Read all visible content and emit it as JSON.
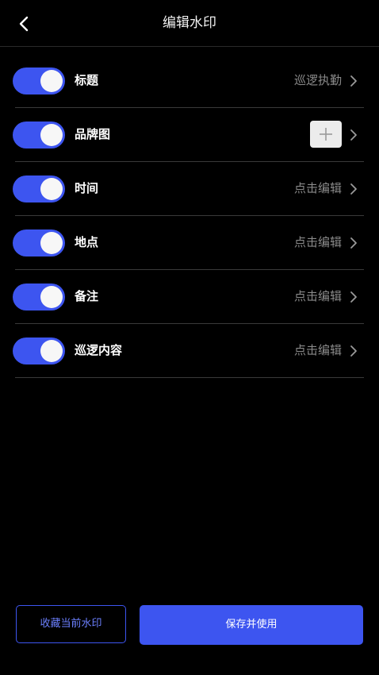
{
  "header": {
    "title": "编辑水印",
    "back_icon": "chevron-left-icon"
  },
  "colors": {
    "background": "#000000",
    "accent": "#3d55f0",
    "value_text": "#8a8a8a",
    "divider": "#3a3a3a"
  },
  "rows": [
    {
      "label": "标题",
      "value": "巡逻执勤",
      "enabled": true
    },
    {
      "label": "品牌图",
      "value": "",
      "enabled": true,
      "add_icon": "plus-icon"
    },
    {
      "label": "时间",
      "value": "点击编辑",
      "enabled": true
    },
    {
      "label": "地点",
      "value": "点击编辑",
      "enabled": true
    },
    {
      "label": "备注",
      "value": "点击编辑",
      "enabled": true
    },
    {
      "label": "巡逻内容",
      "value": "点击编辑",
      "enabled": true
    }
  ],
  "footer": {
    "favorite_label": "收藏当前水印",
    "save_label": "保存并使用"
  }
}
